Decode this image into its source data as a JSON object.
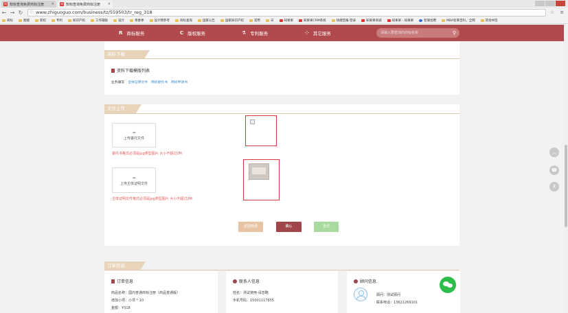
{
  "browser": {
    "tabs": [
      {
        "title": "知标查询免费商标注册",
        "favicon": "知"
      },
      {
        "title": "知标查询免费商标注册",
        "favicon": "知"
      }
    ],
    "url": "www.zhiguoguo.com/business/tz/559503/tr_reg_318",
    "bookmarks": [
      "商标",
      "图搜",
      "新权",
      "专利",
      "知识产权",
      "工作辅助",
      "设计",
      "青春季",
      "设计网参考",
      "商标查询",
      "国家公告",
      "国家知识产权",
      "常用",
      "日",
      "知果果",
      "知果果CRM系统",
      "快捷回报·登录",
      "知果果商城",
      "知果果 - 知果果",
      "智联招聘",
      "MBA智库百科，全网",
      "其他书签"
    ]
  },
  "sitenav": {
    "items": [
      {
        "icon": "R",
        "label": "商标服务"
      },
      {
        "icon": "C",
        "label": "版权服务"
      },
      {
        "icon": "⚗",
        "label": "专利服务"
      },
      {
        "icon": "⁘",
        "label": "其它服务"
      }
    ],
    "search_placeholder": "请输入要查询的商标名称"
  },
  "download_section": {
    "header": "资料下载",
    "subtitle": "资料下载模版列表",
    "row_label": "业务填写",
    "links": [
      "全体证明文件",
      "商标委托书",
      "商标申请书"
    ]
  },
  "upload_section": {
    "header": "文件上传",
    "upload1_label": "上传委托文件",
    "upload1_hint": "委托书格式必须是jpg类型图片 大小不超过2M",
    "upload2_label": "上传主体证明文件",
    "upload2_hint": "主体证明文件格式必须是jpg类型图片 大小不超过2M",
    "buttons": {
      "back": "返回修改",
      "confirm": "确认",
      "pay": "支付"
    }
  },
  "order_section": {
    "header": "订单信息",
    "order_card": {
      "title": "订单信息",
      "lines": [
        "商品名称：国内普通商标注册（商品普通版）",
        "增加小项：小项 * 10",
        "金额：¥318"
      ]
    },
    "contact_card": {
      "title": "联系人信息",
      "lines": [
        "姓名：测试使用-请忽略",
        "手机号码：15001117655"
      ]
    },
    "consultant_card": {
      "title": "顾问信息",
      "lines": [
        "顾问：测试顾问",
        "联系电话：13621269101"
      ]
    }
  },
  "float_buttons": {
    "top": "︿",
    "phone": "☎",
    "qr": "⊼"
  },
  "colors": {
    "brand": "#b04a4e",
    "section_tab": "#e8d4ba",
    "link": "#3a8bd0",
    "hint": "#e45a5a",
    "confirm_btn": "#a0454a",
    "back_btn": "#e8c4a4",
    "pay_btn": "#a9dba0"
  }
}
